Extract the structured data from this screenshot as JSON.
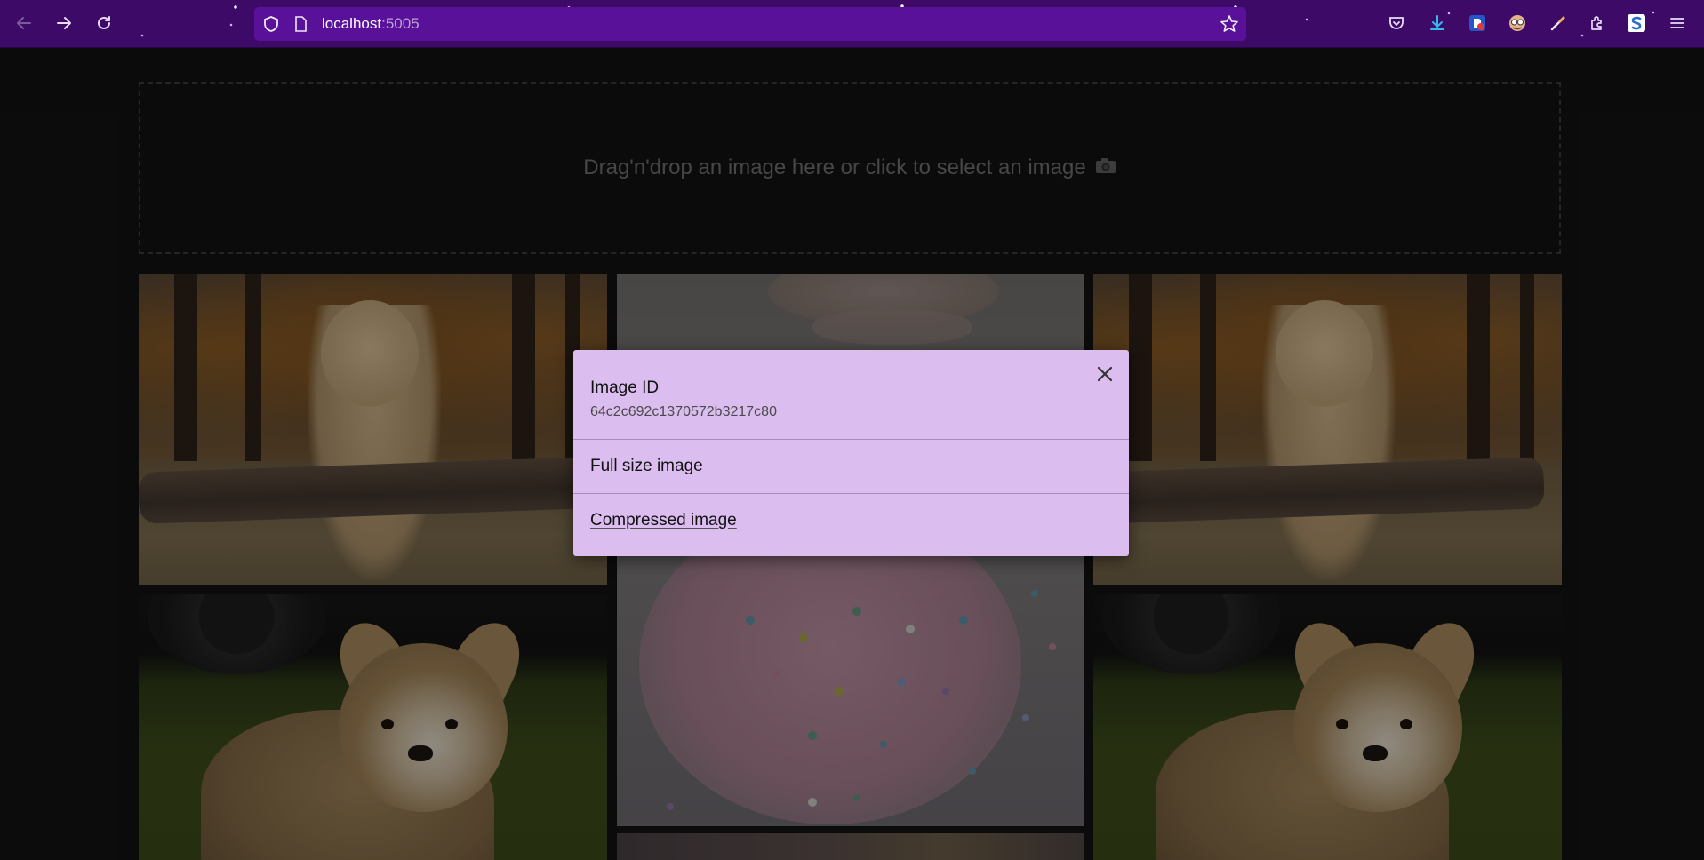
{
  "browser": {
    "url_host": "localhost",
    "url_port": ":5005",
    "icons": [
      "back-icon",
      "forward-icon",
      "reload-icon",
      "shield-icon",
      "page-icon",
      "bookmark-star-icon",
      "pocket-icon",
      "download-icon",
      "extension-icon",
      "avatar-extension-icon",
      "dropper-icon",
      "puzzle-icon",
      "s-extension-icon",
      "menu-icon"
    ]
  },
  "dropzone": {
    "text": "Drag'n'drop an image here or click to select an image"
  },
  "modal": {
    "id_label": "Image ID",
    "id_value": "64c2c692c1370572b3217c80",
    "full_size_link": "Full size image",
    "compressed_link": "Compressed image"
  },
  "colors": {
    "toolbar": "#3d0a68",
    "urlbar": "#5a119a",
    "page_bg": "#121212",
    "modal_bg": "#dbbdef"
  }
}
